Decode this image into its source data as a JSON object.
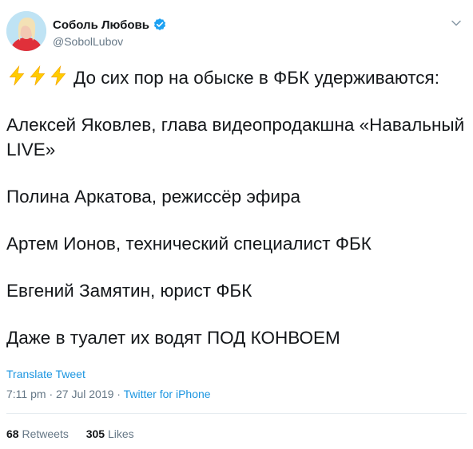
{
  "user": {
    "display_name": "Соболь Любовь",
    "handle": "@SobolLubov",
    "verified": true
  },
  "tweet": {
    "icons": [
      "high-voltage-emoji",
      "high-voltage-emoji",
      "high-voltage-emoji"
    ],
    "paragraphs": [
      "До сих пор на обыске в ФБК удерживаются:",
      "Алексей Яковлев, глава видеопродакшна «Навальный LIVE»",
      "Полина Аркатова, режиссёр эфира",
      "Артем Ионов, технический специалист ФБК",
      "Евгений Замятин, юрист ФБК",
      "Даже в туалет их водят ПОД КОНВОЕМ"
    ],
    "translate_label": "Translate Tweet",
    "time": "7:11 pm",
    "separator": "·",
    "date": "27 Jul 2019",
    "source": "Twitter for iPhone"
  },
  "stats": {
    "retweets_count": "68",
    "retweets_label": "Retweets",
    "likes_count": "305",
    "likes_label": "Likes"
  },
  "colors": {
    "link": "#1b95e0",
    "secondary_text": "#657786",
    "primary_text": "#14171a",
    "verified_badge": "#1da1f2",
    "emoji_bolt": "#ffcc00"
  }
}
